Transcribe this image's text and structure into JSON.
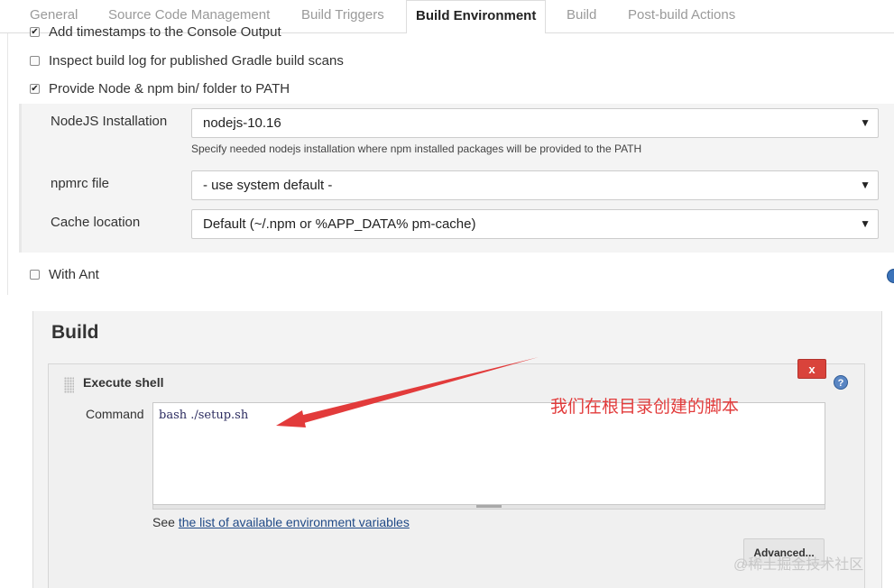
{
  "tabs": [
    {
      "label": "General"
    },
    {
      "label": "Source Code Management"
    },
    {
      "label": "Build Triggers"
    },
    {
      "label": "Build Environment",
      "active": true
    },
    {
      "label": "Build"
    },
    {
      "label": "Post-build Actions"
    }
  ],
  "env_options": {
    "timestamps": {
      "label": "Add timestamps to the Console Output",
      "checked": true
    },
    "gradle": {
      "label": "Inspect build log for published Gradle build scans",
      "checked": false
    },
    "node": {
      "label": "Provide Node & npm bin/ folder to PATH",
      "checked": true
    },
    "ant": {
      "label": "With Ant",
      "checked": false
    }
  },
  "node_config": {
    "installation_label": "NodeJS Installation",
    "installation_value": "nodejs-10.16",
    "installation_hint": "Specify needed nodejs installation where npm installed packages will be provided to the PATH",
    "npmrc_label": "npmrc file",
    "npmrc_value": "- use system default -",
    "cache_label": "Cache location",
    "cache_value": "Default (~/.npm or %APP_DATA% pm-cache)"
  },
  "build": {
    "title": "Build",
    "step_title": "Execute shell",
    "delete_label": "x",
    "help_label": "?",
    "command_label": "Command",
    "command_value": "bash ./setup.sh",
    "see_prefix": "See ",
    "see_link": "the list of available environment variables",
    "advanced_label": "Advanced..."
  },
  "annotation": {
    "text": "我们在根目录创建的脚本",
    "color": "#e23b3b"
  },
  "watermark": {
    "text": "@稀土掘金技术社区"
  },
  "icons": {
    "checked": "✔",
    "caret": "▼"
  },
  "colors": {
    "accent": "#204a87",
    "danger": "#d9433b",
    "annotation": "#e23b3b"
  }
}
